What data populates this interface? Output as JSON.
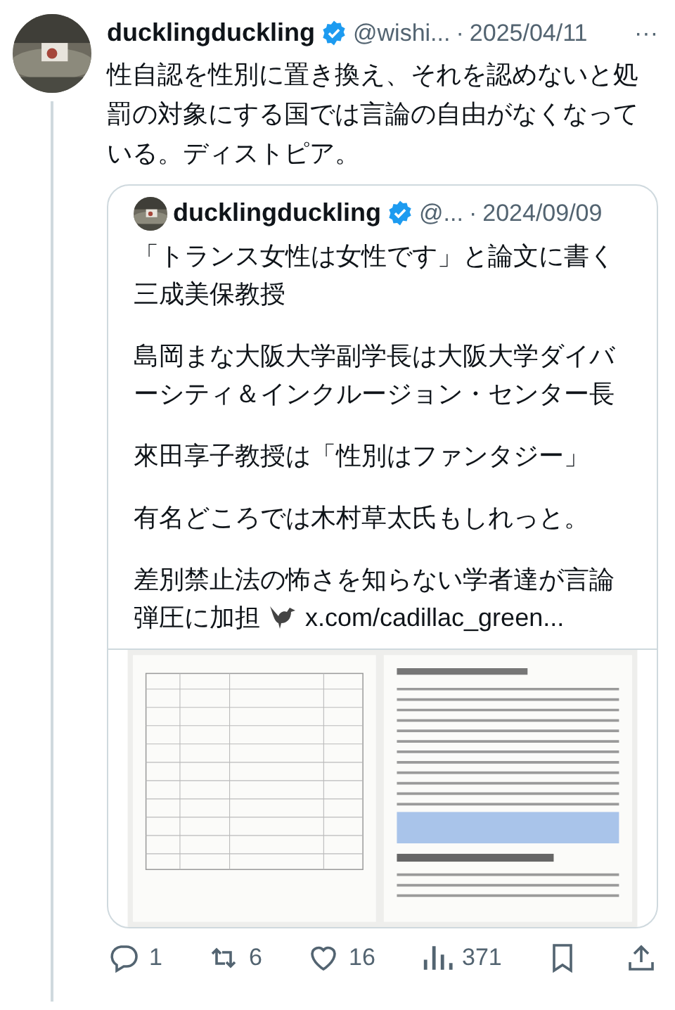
{
  "post": {
    "author": {
      "name": "ducklingduckling",
      "verified": true,
      "handle": "@wishi...",
      "separator": "·",
      "date": "2025/04/11"
    },
    "more": "···",
    "text": "性自認を性別に置き換え、それを認めないと処罰の対象にする国では言論の自由がなくなっている。ディストピア。",
    "quote": {
      "author": {
        "name": "ducklingduckling",
        "verified": true,
        "handle": "@...",
        "separator": "·",
        "date": "2024/09/09"
      },
      "paragraphs": [
        {
          "text": "「トランス女性は女性です」と論文に書く三成美保教授"
        },
        {
          "text": "島岡まな大阪大学副学長は大阪大学ダイバーシティ＆インクルージョン・センター長"
        },
        {
          "text": "來田享子教授は「性別はファンタジー」"
        },
        {
          "text": "有名どころでは木村草太氏もしれっと。"
        },
        {
          "text": "差別禁止法の怖さを知らない学者達が言論弾圧に加担",
          "bird": true,
          "link": "x.com/cadillac_green..."
        }
      ]
    },
    "actions": [
      {
        "kind": "reply",
        "count": "1"
      },
      {
        "kind": "repost",
        "count": "6"
      },
      {
        "kind": "like",
        "count": "16"
      },
      {
        "kind": "views",
        "count": "371"
      },
      {
        "kind": "bookmark"
      },
      {
        "kind": "share"
      }
    ]
  }
}
